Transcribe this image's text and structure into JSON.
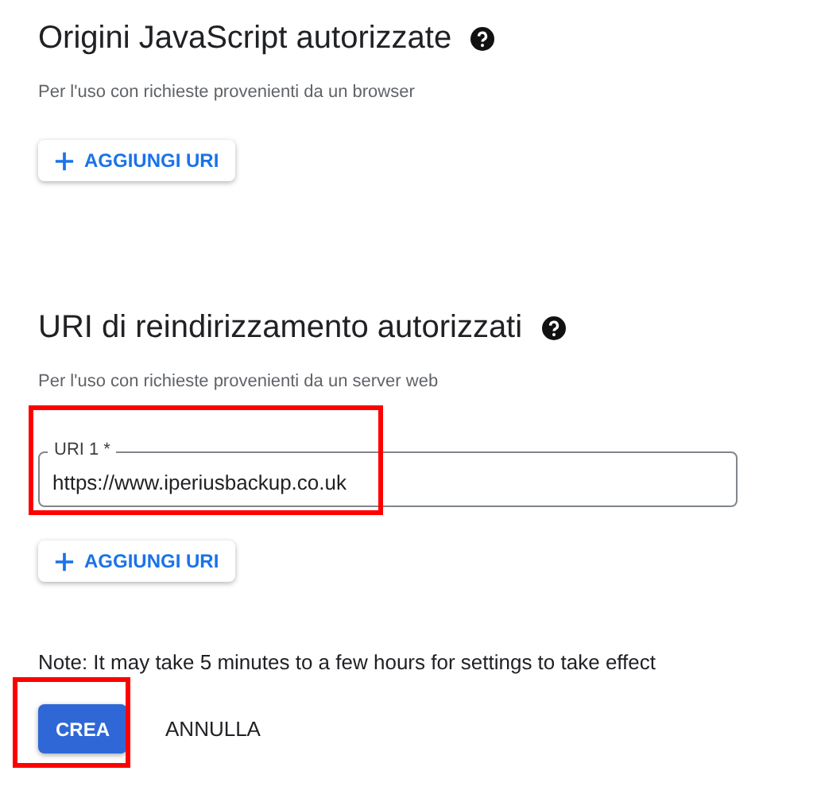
{
  "sections": [
    {
      "title": "Origini JavaScript autorizzate",
      "description": "Per l'uso con richieste provenienti da un browser",
      "add_button": "AGGIUNGI URI"
    },
    {
      "title": "URI di reindirizzamento autorizzati",
      "description": "Per l'uso con richieste provenienti da un server web",
      "uris": [
        {
          "label": "URI 1 *",
          "value": "https://www.iperiusbackup.co.uk",
          "highlighted": true
        }
      ],
      "add_button": "AGGIUNGI URI"
    }
  ],
  "note": "Note: It may take 5 minutes to a few hours for settings to take effect",
  "buttons": [
    {
      "label": "CREA",
      "kind": "primary",
      "highlighted": true
    },
    {
      "label": "ANNULLA",
      "kind": "text",
      "highlighted": false
    }
  ]
}
